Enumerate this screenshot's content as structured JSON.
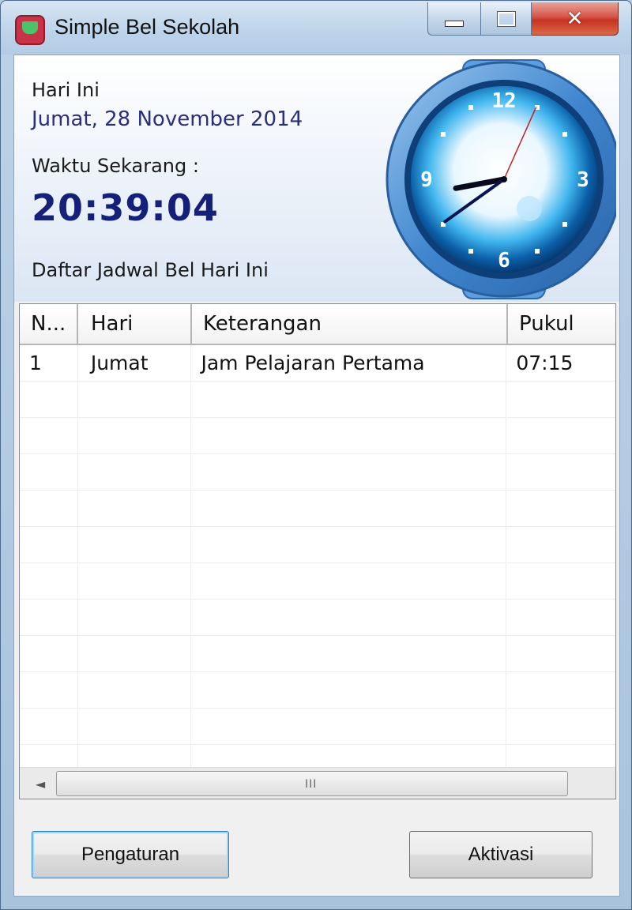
{
  "window": {
    "title": "Simple Bel Sekolah",
    "icon": "app-bell-icon",
    "controls": {
      "minimize_icon": "minimize-icon",
      "maximize_icon": "maximize-icon",
      "close_glyph": "✕"
    }
  },
  "info": {
    "today_label": "Hari Ini",
    "date_value": "Jumat, 28 November 2014",
    "now_label": "Waktu Sekarang  :",
    "time_value": "20:39:04",
    "schedule_label": "Daftar Jadwal Bel Hari Ini"
  },
  "clock": {
    "numerals": {
      "n12": "12",
      "n3": "3",
      "n6": "6",
      "n9": "9"
    },
    "time": {
      "hour": 20,
      "minute": 39,
      "second": 4
    }
  },
  "table": {
    "headers": [
      "N...",
      "Hari",
      "Keterangan",
      "Pukul"
    ],
    "rows": [
      [
        "1",
        "Jumat",
        "Jam Pelajaran Pertama",
        "07:15"
      ],
      [
        "",
        "",
        "",
        ""
      ],
      [
        "",
        "",
        "",
        ""
      ],
      [
        "",
        "",
        "",
        ""
      ],
      [
        "",
        "",
        "",
        ""
      ],
      [
        "",
        "",
        "",
        ""
      ],
      [
        "",
        "",
        "",
        ""
      ],
      [
        "",
        "",
        "",
        ""
      ],
      [
        "",
        "",
        "",
        ""
      ],
      [
        "",
        "",
        "",
        ""
      ],
      [
        "",
        "",
        "",
        ""
      ],
      [
        "",
        "",
        "",
        ""
      ]
    ],
    "scrollbar": {
      "left_arrow": "◄",
      "grip": "III"
    }
  },
  "buttons": {
    "settings": "Pengaturan",
    "activate": "Aktivasi"
  },
  "colors": {
    "date_text": "#2a2f7c",
    "time_text": "#15207a",
    "clock_blue": "#2f7cc8",
    "close_red": "#c7321f"
  }
}
